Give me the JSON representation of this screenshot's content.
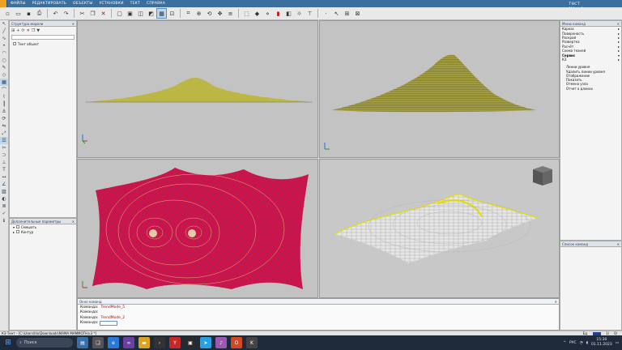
{
  "menubar": {
    "items": [
      "ФАЙЛЫ",
      "РЕДАКТИРОВАТЬ",
      "ОБЪЕКТЫ",
      "УСТАНОВКИ",
      "ТЕКТ",
      "СПРАВКА"
    ],
    "user": "Ох. тест (Мод)"
  },
  "toolbar": {
    "icons": [
      "new-icon",
      "open-icon",
      "save-icon",
      "print-icon",
      "cut-icon",
      "copy-icon",
      "paste-icon",
      "delete-icon",
      "view-icon",
      "view-icon",
      "view-icon",
      "view-icon",
      "view-icon",
      "view-icon",
      "tool-icon",
      "tool-icon",
      "tool-icon",
      "tool-icon",
      "tool-icon",
      "tool-icon",
      "tool-icon",
      "tool-icon",
      "tool-icon",
      "tool-icon",
      "tool-icon",
      "tool-icon"
    ]
  },
  "structpanel": {
    "title": "Структура модели",
    "tree_item": "Тент объект"
  },
  "addparams": {
    "title": "Дополнительные параметры",
    "items": [
      "Смешать",
      "Контур"
    ]
  },
  "rightpanel": {
    "title": "Меню команд",
    "menu": [
      {
        "label": "Каркас",
        "bold": false
      },
      {
        "label": "Поверхность",
        "bold": false
      },
      {
        "label": "Раскрой",
        "bold": false
      },
      {
        "label": "Развертка",
        "bold": false
      },
      {
        "label": "Расчёт",
        "bold": false
      },
      {
        "label": "Схема тканей",
        "bold": false
      },
      {
        "label": "Сервис",
        "bold": true
      },
      {
        "label": "К3",
        "bold": false
      }
    ],
    "submenu": [
      "Линии уровня",
      "Удалить линии уровня",
      "Отображение",
      "Показать",
      "Отмена узла",
      "Отчет о длинах"
    ]
  },
  "selpanel": {
    "title": "Список команд"
  },
  "cmdwin": {
    "title": "Окно команд",
    "lines": [
      {
        "prefix": "Команда:",
        "value": "TrendMode_5"
      },
      {
        "prefix": "Команда:",
        "value": ""
      },
      {
        "prefix": "Команда:",
        "value": "TrendMode_2"
      }
    ],
    "prompt": "Команда:"
  },
  "statusbar": {
    "left": "К3-Тент - [C:\\Users\\Ilio\\Downloads\\MAMA MAMMOTH.k3 *]",
    "scale": "Ед.",
    "coords": "1/",
    "zoom": "0/"
  },
  "taskbar": {
    "search": "Поиск",
    "lang": "РУС",
    "time": "15:30",
    "date": "01.11.2023"
  },
  "colors": {
    "membrane_yellow": "#c8c24a",
    "membrane_red": "#d0144a",
    "viewport_bg": "#c3c3c3",
    "titlebar": "#3c6e9e"
  }
}
